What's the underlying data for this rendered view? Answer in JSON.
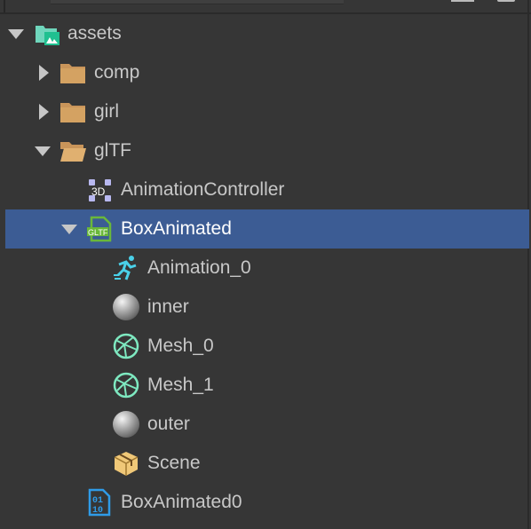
{
  "tree": [
    {
      "label": "assets",
      "icon": "assets-folder-icon",
      "level": 0,
      "expand": "down"
    },
    {
      "label": "comp",
      "icon": "folder-icon",
      "level": 1,
      "expand": "right"
    },
    {
      "label": "girl",
      "icon": "folder-icon",
      "level": 1,
      "expand": "right"
    },
    {
      "label": "glTF",
      "icon": "folder-open-icon",
      "level": 1,
      "expand": "down"
    },
    {
      "label": "AnimationController",
      "icon": "animation-controller-3d-icon",
      "level": 2,
      "expand": ""
    },
    {
      "label": "BoxAnimated",
      "icon": "gltf-file-icon",
      "level": 2,
      "expand": "down",
      "selected": true
    },
    {
      "label": "Animation_0",
      "icon": "animation-clip-icon",
      "level": 3,
      "expand": ""
    },
    {
      "label": "inner",
      "icon": "material-sphere-icon",
      "level": 3,
      "expand": ""
    },
    {
      "label": "Mesh_0",
      "icon": "mesh-icon",
      "level": 3,
      "expand": ""
    },
    {
      "label": "Mesh_1",
      "icon": "mesh-icon",
      "level": 3,
      "expand": ""
    },
    {
      "label": "outer",
      "icon": "material-sphere-icon",
      "level": 3,
      "expand": ""
    },
    {
      "label": "Scene",
      "icon": "prefab-box-icon",
      "level": 3,
      "expand": ""
    },
    {
      "label": "BoxAnimated0",
      "icon": "binary-file-icon",
      "level": 2,
      "expand": ""
    }
  ],
  "colors": {
    "background": "#363636",
    "selection": "#3c5c94",
    "text": "#c8c8c8"
  }
}
